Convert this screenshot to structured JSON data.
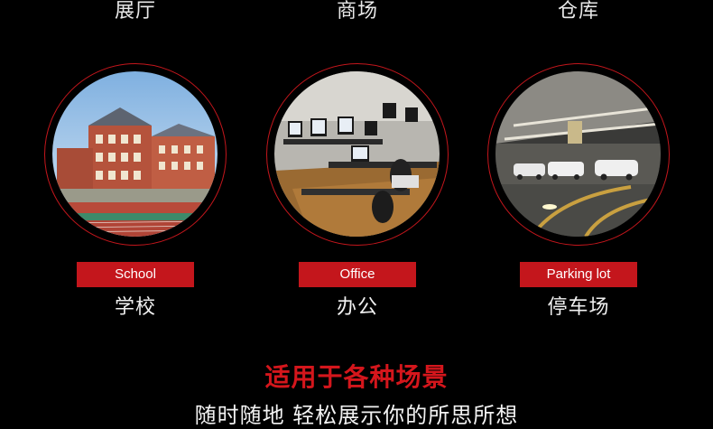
{
  "top_labels": [
    "展厅",
    "商场",
    "仓库"
  ],
  "scenes": [
    {
      "image": "school-building-photo",
      "badge": "School",
      "label": "学校"
    },
    {
      "image": "office-desks-photo",
      "badge": "Office",
      "label": "办公"
    },
    {
      "image": "parking-garage-photo",
      "badge": "Parking lot",
      "label": "停车场"
    }
  ],
  "headline": "适用于各种场景",
  "subline": "随时随地 轻松展示你的所思所想",
  "colors": {
    "accent": "#c4161c",
    "background": "#000000"
  }
}
